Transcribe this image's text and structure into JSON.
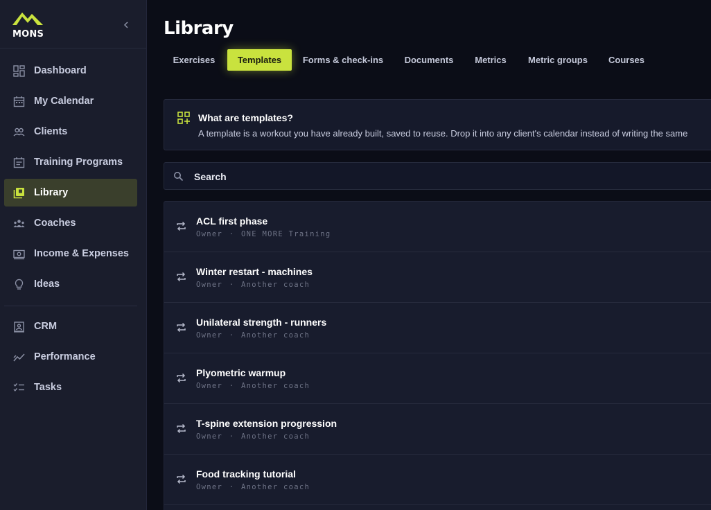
{
  "brand": {
    "name": "MONS",
    "accent": "#c9e23e"
  },
  "sidebar": {
    "items": [
      {
        "label": "Dashboard",
        "icon": "dashboard-icon"
      },
      {
        "label": "My Calendar",
        "icon": "calendar-icon"
      },
      {
        "label": "Clients",
        "icon": "clients-icon"
      },
      {
        "label": "Training Programs",
        "icon": "training-programs-icon"
      },
      {
        "label": "Library",
        "icon": "library-icon",
        "active": true
      },
      {
        "label": "Coaches",
        "icon": "coaches-icon"
      },
      {
        "label": "Income & Expenses",
        "icon": "income-icon"
      },
      {
        "label": "Ideas",
        "icon": "lightbulb-icon"
      },
      {
        "label": "CRM",
        "icon": "crm-icon"
      },
      {
        "label": "Performance",
        "icon": "performance-icon"
      },
      {
        "label": "Tasks",
        "icon": "tasks-icon"
      }
    ]
  },
  "page": {
    "title": "Library"
  },
  "tabs": [
    {
      "label": "Exercises"
    },
    {
      "label": "Templates",
      "active": true
    },
    {
      "label": "Forms & check-ins"
    },
    {
      "label": "Documents"
    },
    {
      "label": "Metrics"
    },
    {
      "label": "Metric groups"
    },
    {
      "label": "Courses"
    }
  ],
  "info": {
    "title": "What are templates?",
    "text": "A template is a workout you have already built, saved to reuse. Drop it into any client's calendar instead of writing the same"
  },
  "search": {
    "placeholder": "Search"
  },
  "templates": [
    {
      "title": "ACL first phase",
      "role": "Owner",
      "owner": "ONE MORE Training"
    },
    {
      "title": "Winter restart - machines",
      "role": "Owner",
      "owner": "Another coach"
    },
    {
      "title": "Unilateral strength - runners",
      "role": "Owner",
      "owner": "Another coach"
    },
    {
      "title": "Plyometric warmup",
      "role": "Owner",
      "owner": "Another coach"
    },
    {
      "title": "T-spine extension progression",
      "role": "Owner",
      "owner": "Another coach"
    },
    {
      "title": "Food tracking tutorial",
      "role": "Owner",
      "owner": "Another coach"
    }
  ],
  "meta_separator": "·"
}
